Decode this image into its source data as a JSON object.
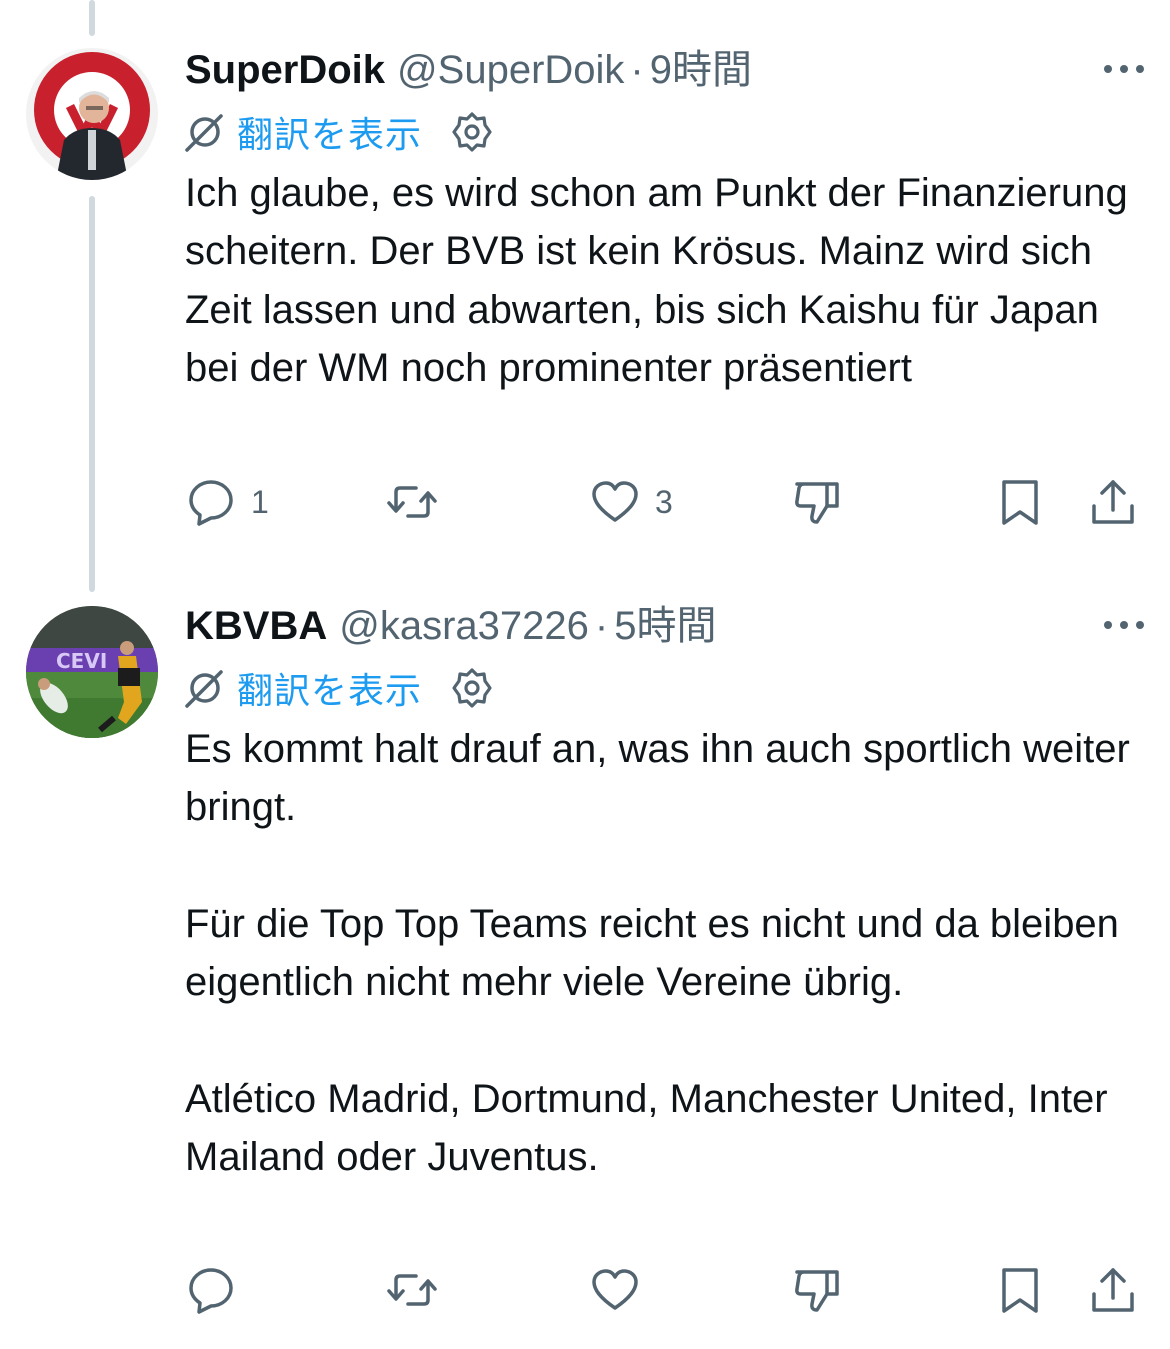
{
  "tweets": [
    {
      "name": "SuperDoik",
      "handle": "@SuperDoik",
      "separator": "·",
      "time": "9時間",
      "translate_label": "翻訳を表示",
      "text_paragraphs": [
        "Ich glaube, es wird schon am Punkt der Finanzierung scheitern. Der BVB ist kein Krösus. Mainz wird sich Zeit lassen und abwarten, bis sich Kaishu für Japan bei der WM noch prominenter präsentiert"
      ],
      "reply_count": "1",
      "like_count": "3",
      "avatar_icon": "avatar-mainz-coach"
    },
    {
      "name": "KBVBA",
      "handle": "@kasra37226",
      "separator": "·",
      "time": "5時間",
      "translate_label": "翻訳を表示",
      "text_paragraphs": [
        "Es kommt halt drauf an, was ihn auch sportlich weiter bringt.",
        "Für die Top Top Teams reicht es nicht und da bleiben eigentlich nicht mehr viele Vereine übrig.",
        "Atlético Madrid, Dortmund, Manchester United, Inter Mailand oder Juventus."
      ],
      "reply_count": "",
      "like_count": "",
      "avatar_icon": "avatar-football-match"
    }
  ],
  "icons": {
    "translate": "translate-icon",
    "settings": "gear-icon",
    "reply": "reply-icon",
    "retweet": "retweet-icon",
    "like": "heart-icon",
    "dislike": "dislike-icon",
    "bookmark": "bookmark-icon",
    "share": "share-icon",
    "more": "more-icon"
  },
  "colors": {
    "text": "#0f1419",
    "secondary": "#536471",
    "link": "#1d9bf0",
    "thread_line": "#cfd9de"
  }
}
